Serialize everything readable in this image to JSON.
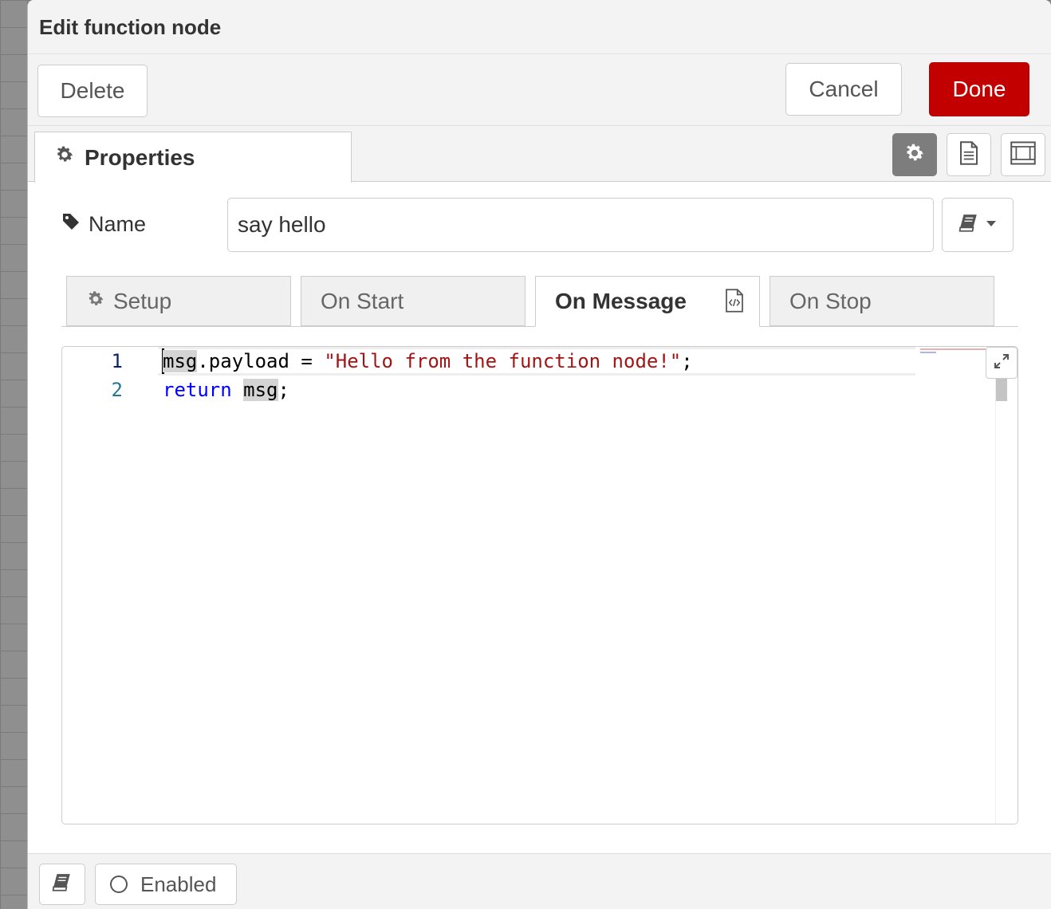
{
  "dialog": {
    "title": "Edit function node"
  },
  "buttons": {
    "delete": "Delete",
    "cancel": "Cancel",
    "done": "Done"
  },
  "colors": {
    "primary": "#c20000",
    "active_tab_icon_bg": "#7d7d7d"
  },
  "properties_tab": {
    "label": "Properties",
    "icon": "gear-icon"
  },
  "sidebar_toggle_icons": [
    "gear-icon",
    "document-icon",
    "frame-icon"
  ],
  "name_field": {
    "label": "Name",
    "value": "say hello",
    "icon": "tag-icon"
  },
  "function_tabs": [
    {
      "label": "Setup",
      "icon": "gear-icon",
      "active": false
    },
    {
      "label": "On Start",
      "active": false
    },
    {
      "label": "On Message",
      "active": true,
      "icon": "code-doc-icon"
    },
    {
      "label": "On Stop",
      "active": false
    }
  ],
  "editor": {
    "lines": [
      {
        "number": "1",
        "var": "msg",
        "rest": ".payload = ",
        "string": "\"Hello from the function node!\"",
        "end": ";"
      },
      {
        "number": "2",
        "keyword": "return",
        "var": "msg",
        "end": ";"
      }
    ]
  },
  "footer": {
    "enabled_label": "Enabled"
  }
}
